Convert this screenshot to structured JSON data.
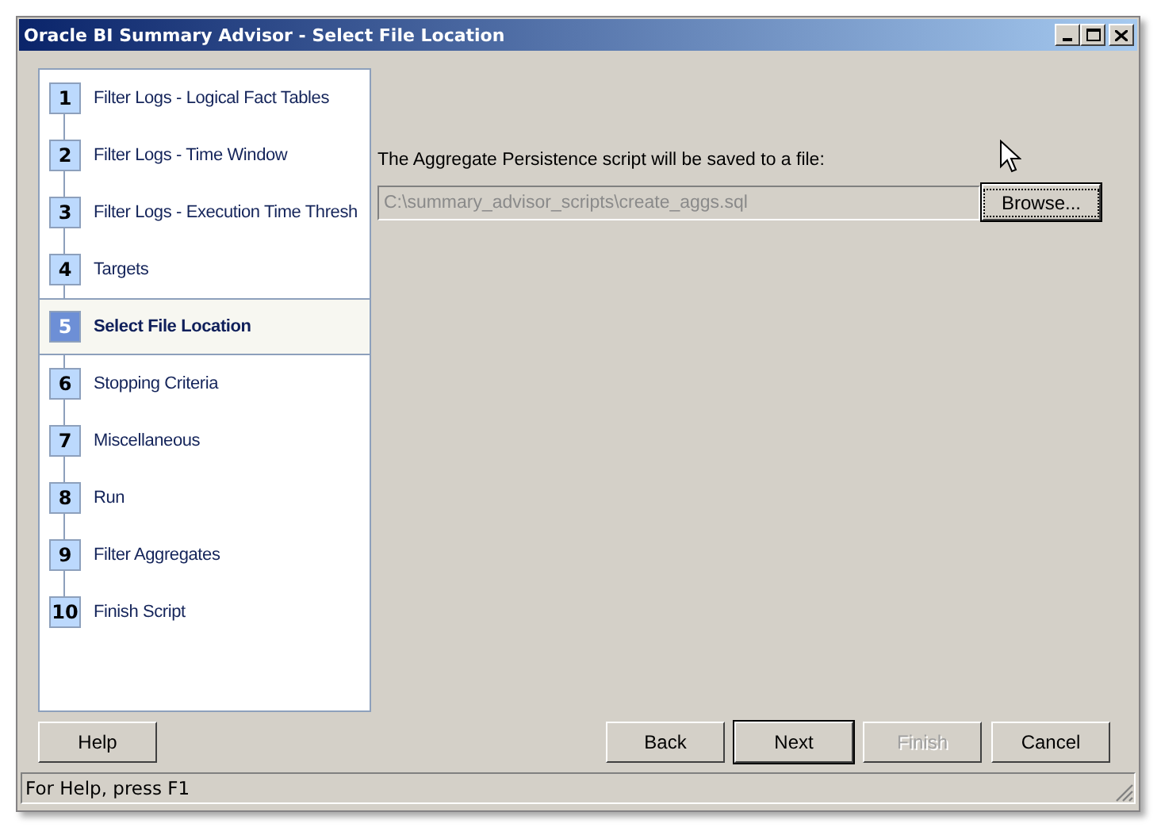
{
  "window": {
    "title": "Oracle BI Summary Advisor - Select File Location"
  },
  "steps": [
    {
      "number": "1",
      "label": "Filter Logs - Logical Fact Tables",
      "selected": false
    },
    {
      "number": "2",
      "label": "Filter Logs - Time Window",
      "selected": false
    },
    {
      "number": "3",
      "label": "Filter Logs - Execution Time Thresh",
      "selected": false
    },
    {
      "number": "4",
      "label": "Targets",
      "selected": false
    },
    {
      "number": "5",
      "label": "Select File Location",
      "selected": true
    },
    {
      "number": "6",
      "label": "Stopping Criteria",
      "selected": false
    },
    {
      "number": "7",
      "label": "Miscellaneous",
      "selected": false
    },
    {
      "number": "8",
      "label": "Run",
      "selected": false
    },
    {
      "number": "9",
      "label": "Filter Aggregates",
      "selected": false
    },
    {
      "number": "10",
      "label": "Finish Script",
      "selected": false
    }
  ],
  "prompt": "The Aggregate Persistence script will be saved to a file:",
  "file_field": {
    "value": "C:\\summary_advisor_scripts\\create_aggs.sql",
    "disabled": true
  },
  "browse_button": {
    "label": "Browse...",
    "focused": true
  },
  "help_button": {
    "label": "Help"
  },
  "nav_buttons": [
    {
      "label": "Back",
      "disabled": false,
      "default": false
    },
    {
      "label": "Next",
      "disabled": false,
      "default": true
    },
    {
      "label": "Finish",
      "disabled": true,
      "default": false
    },
    {
      "label": "Cancel",
      "disabled": false,
      "default": false
    }
  ],
  "status_bar": "For Help, press F1"
}
